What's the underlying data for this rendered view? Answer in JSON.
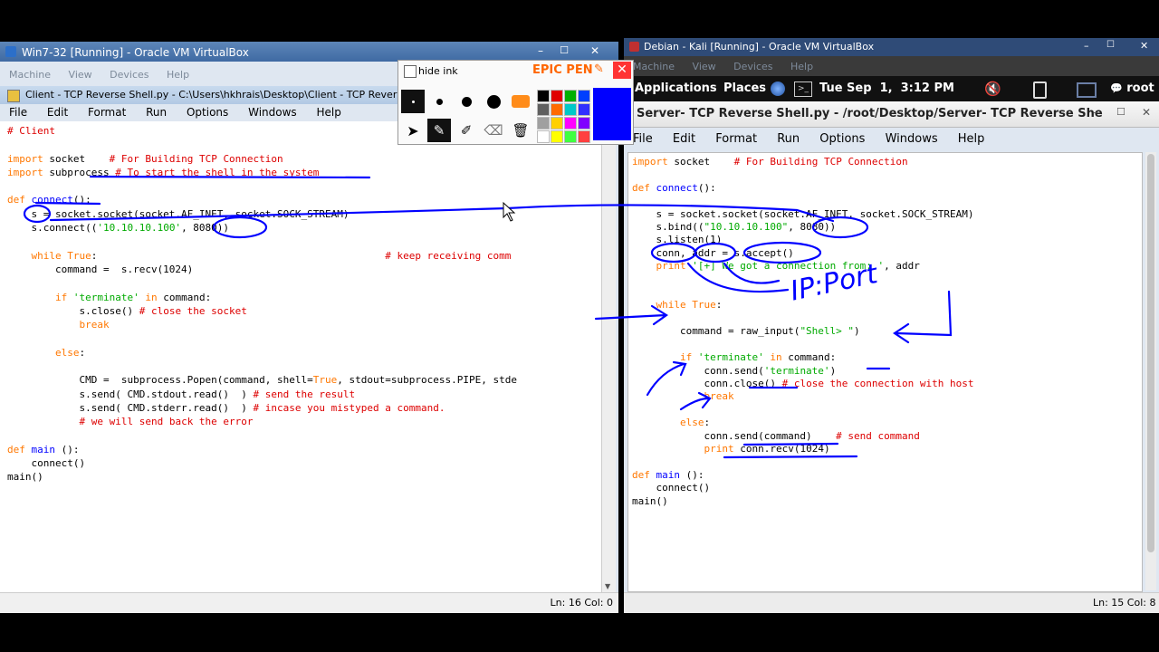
{
  "left_vm": {
    "title": "Win7-32 [Running] - Oracle VM VirtualBox",
    "menu": [
      "Machine",
      "View",
      "Devices",
      "Help"
    ],
    "editor_title": "Client - TCP Reverse Shell.py - C:\\Users\\hkhrais\\Desktop\\Client - TCP Reverse She",
    "editor_menu": [
      "File",
      "Edit",
      "Format",
      "Run",
      "Options",
      "Windows",
      "Help"
    ],
    "status": "Ln: 16 Col: 0"
  },
  "epic_pen": {
    "hide_ink": "hide ink",
    "brand": "EPIC PEN",
    "palette": [
      "#000000",
      "#e00000",
      "#00b000",
      "#0040ff",
      "#606060",
      "#ff6a00",
      "#00c8c8",
      "#3030ff",
      "#a0a0a0",
      "#ffd000",
      "#ff00ff",
      "#8000ff",
      "#ffffff",
      "#ffff00",
      "#40ff40",
      "#ff4040"
    ],
    "active_color": "#0000ff"
  },
  "right_vm": {
    "title": "Debian - Kali [Running] - Oracle VM VirtualBox",
    "menu": [
      "Machine",
      "View",
      "Devices",
      "Help"
    ],
    "panel": {
      "applications": "Applications",
      "places": "Places",
      "clock": "Tue Sep  1,  3:12 PM",
      "user": "root"
    },
    "editor_title": "Server- TCP Reverse Shell.py - /root/Desktop/Server- TCP Reverse She",
    "editor_menu": [
      "File",
      "Edit",
      "Format",
      "Run",
      "Options",
      "Windows",
      "Help"
    ],
    "status": "Ln: 15 Col: 8"
  },
  "annotation": {
    "handwriting": "IP:Port"
  }
}
